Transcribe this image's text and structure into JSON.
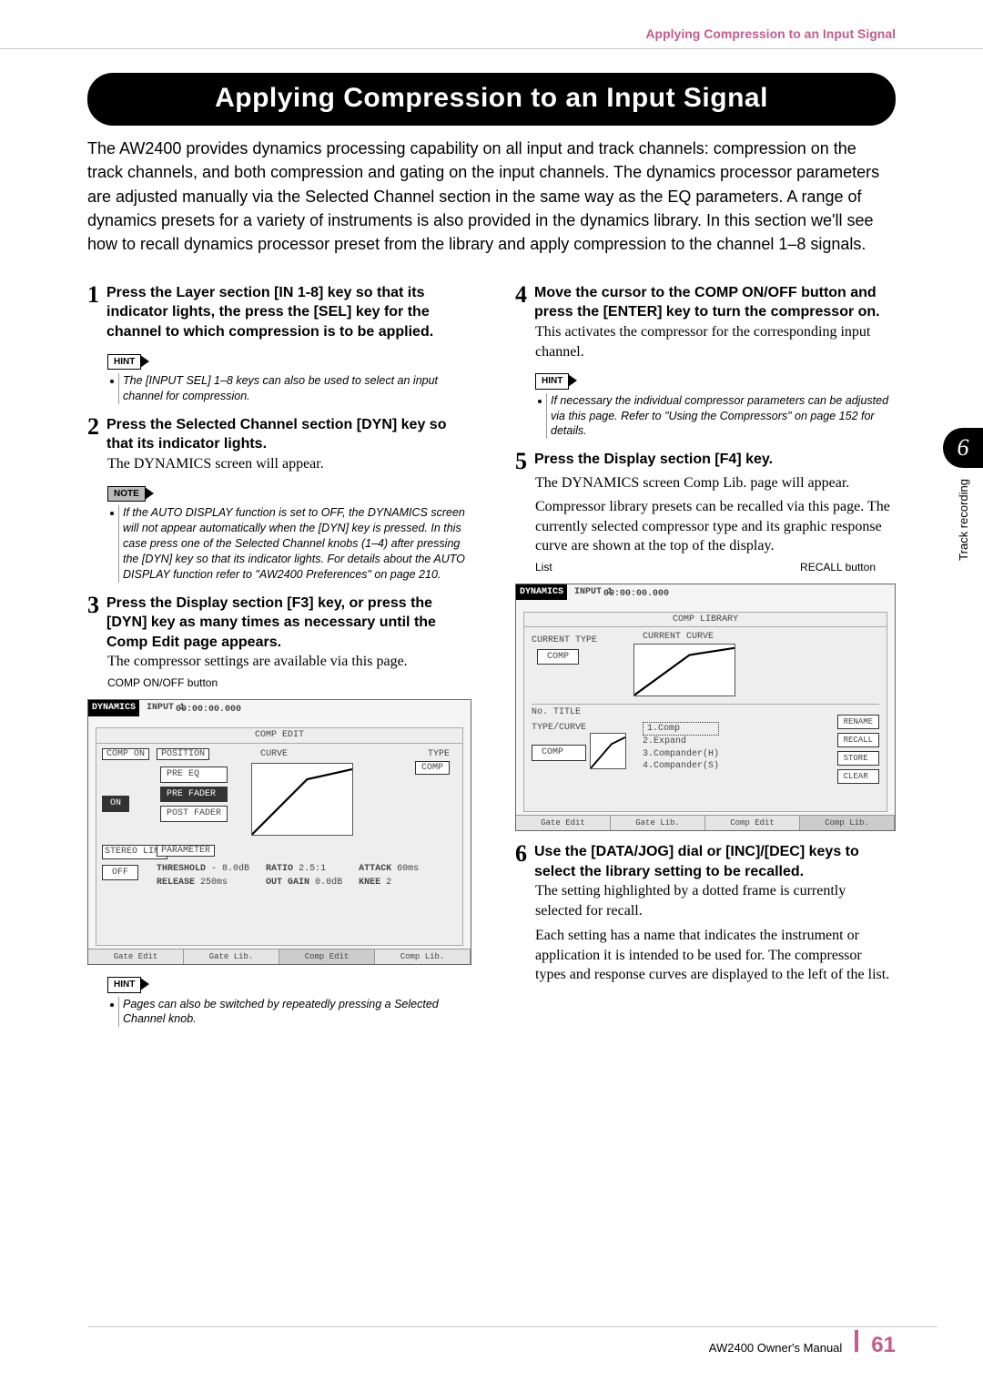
{
  "page": {
    "running_header": "Applying Compression to an Input Signal"
  },
  "title": "Applying Compression to an Input Signal",
  "intro": "The AW2400 provides dynamics processing capability on all input and track channels: compression on the track channels, and both compression and gating on the input channels. The dynamics processor parameters are adjusted manually via the Selected Channel section in the same way as the EQ parameters. A range of dynamics presets for a variety of instruments is also provided in the dynamics library.\nIn this section we'll see how to recall dynamics processor preset from the library and apply compression to the channel 1–8 signals.",
  "left": {
    "step1": {
      "num": "1",
      "heading": "Press the Layer section [IN 1-8] key so that its indicator lights, the press the [SEL] key for the channel to which compression is to be applied.",
      "hint_label": "HINT",
      "hint_text": "The [INPUT SEL] 1–8 keys can also be used to select an input channel for compression."
    },
    "step2": {
      "num": "2",
      "heading": "Press the Selected Channel section [DYN] key so that its indicator lights.",
      "body": "The DYNAMICS screen will appear.",
      "note_label": "NOTE",
      "note_text": "If the AUTO DISPLAY function is set to OFF, the DYNAMICS screen will not appear automatically when the [DYN] key is pressed. In this case press one of the Selected Channel knobs (1–4) after pressing the [DYN] key so that its indicator lights. For details about the AUTO DISPLAY function refer to \"AW2400 Preferences\" on page 210."
    },
    "step3": {
      "num": "3",
      "heading": "Press the Display section [F3] key, or press the [DYN] key as many times as necessary until the Comp Edit page appears.",
      "body": "The compressor settings are available via this page."
    },
    "fig1": {
      "caption": "COMP ON/OFF button",
      "panel_title": "DYNAMICS",
      "sub_title": "INPUT 1",
      "time": "00:00:00.000",
      "section_label": "COMP EDIT",
      "curve_label": "CURVE",
      "type_label": "TYPE",
      "type_value": "COMP",
      "position_label": "POSITION",
      "pos_options": [
        "PRE EQ",
        "PRE FADER",
        "POST FADER"
      ],
      "on_label": "COMP ON",
      "on_value": "ON",
      "stereo_label": "STEREO LINK",
      "stereo_value": "OFF",
      "param_label": "PARAMETER",
      "params": [
        {
          "name": "THRESHOLD",
          "value": "- 8.0dB"
        },
        {
          "name": "RATIO",
          "value": "2.5:1"
        },
        {
          "name": "ATTACK",
          "value": "60ms"
        },
        {
          "name": "RELEASE",
          "value": "250ms"
        },
        {
          "name": "OUT GAIN",
          "value": "0.0dB"
        },
        {
          "name": "KNEE",
          "value": "2"
        }
      ],
      "tabs": [
        "Gate Edit",
        "Gate Lib.",
        "Comp Edit",
        "Comp Lib."
      ]
    },
    "hint2_label": "HINT",
    "hint2_text": "Pages can also be switched by repeatedly pressing a Selected Channel knob."
  },
  "right": {
    "step4": {
      "num": "4",
      "heading": "Move the cursor to the COMP ON/OFF button and press the [ENTER] key to turn the compressor on.",
      "body": "This activates the compressor for the corresponding input channel.",
      "hint_label": "HINT",
      "hint_text": "If necessary the individual compressor parameters can be adjusted via this page. Refer to \"Using the Compressors\" on page 152 for details."
    },
    "step5": {
      "num": "5",
      "heading": "Press the Display section [F4] key.",
      "body1": "The DYNAMICS screen Comp Lib. page will appear.",
      "body2": "Compressor library presets can be recalled via this page. The currently selected compressor type and its graphic response curve are shown at the top of the display."
    },
    "fig2": {
      "callout_left": "List",
      "callout_right": "RECALL button",
      "panel_title": "DYNAMICS",
      "sub_title": "INPUT 1",
      "time": "00:00:00.000",
      "section_label": "COMP LIBRARY",
      "current_label": "CURRENT TYPE",
      "current_value": "COMP",
      "curve_label": "CURRENT CURVE",
      "list_header": "No. TITLE",
      "type_curve_label": "TYPE/CURVE",
      "type_curve_value": "COMP",
      "items": [
        "1.Comp",
        "2.Expand",
        "3.Compander(H)",
        "4.Compander(S)"
      ],
      "buttons": [
        "RENAME",
        "RECALL",
        "STORE",
        "CLEAR"
      ],
      "tabs": [
        "Gate Edit",
        "Gate Lib.",
        "Comp Edit",
        "Comp Lib."
      ]
    },
    "step6": {
      "num": "6",
      "heading": "Use the [DATA/JOG] dial or [INC]/[DEC] keys to select the library setting to be recalled.",
      "body1": "The setting highlighted by a dotted frame is currently selected for recall.",
      "body2": "Each setting has a name that indicates the instrument or application it is intended to be used for. The compressor types and response curves are displayed to the left of the list."
    }
  },
  "side_tab": {
    "num": "6",
    "label": "Track recording"
  },
  "footer": {
    "manual": "AW2400  Owner's Manual",
    "page": "61"
  }
}
